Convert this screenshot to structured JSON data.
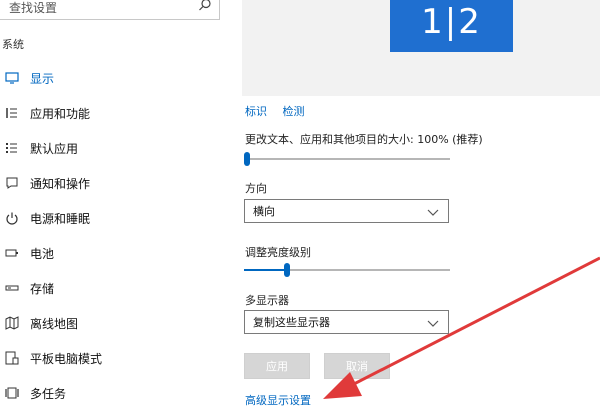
{
  "search": {
    "placeholder": "查找设置"
  },
  "sidebar": {
    "section_title": "系统",
    "items": [
      {
        "label": "显示",
        "icon": "monitor-icon",
        "active": true
      },
      {
        "label": "应用和功能",
        "icon": "apps-list-icon"
      },
      {
        "label": "默认应用",
        "icon": "default-apps-icon"
      },
      {
        "label": "通知和操作",
        "icon": "notification-icon"
      },
      {
        "label": "电源和睡眠",
        "icon": "power-icon"
      },
      {
        "label": "电池",
        "icon": "battery-icon"
      },
      {
        "label": "存储",
        "icon": "storage-icon"
      },
      {
        "label": "离线地图",
        "icon": "map-icon"
      },
      {
        "label": "平板电脑模式",
        "icon": "tablet-mode-icon"
      },
      {
        "label": "多任务",
        "icon": "multitask-icon"
      }
    ]
  },
  "preview": {
    "monitor_number": "1|2"
  },
  "links": {
    "identify": "标识",
    "detect": "检测"
  },
  "scaling": {
    "label": "更改文本、应用和其他项目的大小: 100% (推荐)",
    "value": 0.0
  },
  "orientation": {
    "label": "方向",
    "value": "横向"
  },
  "brightness": {
    "label": "调整亮度级别",
    "value": 0.2
  },
  "multi_display": {
    "label": "多显示器",
    "value": "复制这些显示器"
  },
  "buttons": {
    "apply": "应用",
    "cancel": "取消"
  },
  "advanced_link": "高级显示设置",
  "colors": {
    "accent": "#0067c0",
    "monitor": "#1f6fd0",
    "annotation": "#e03a3a"
  }
}
